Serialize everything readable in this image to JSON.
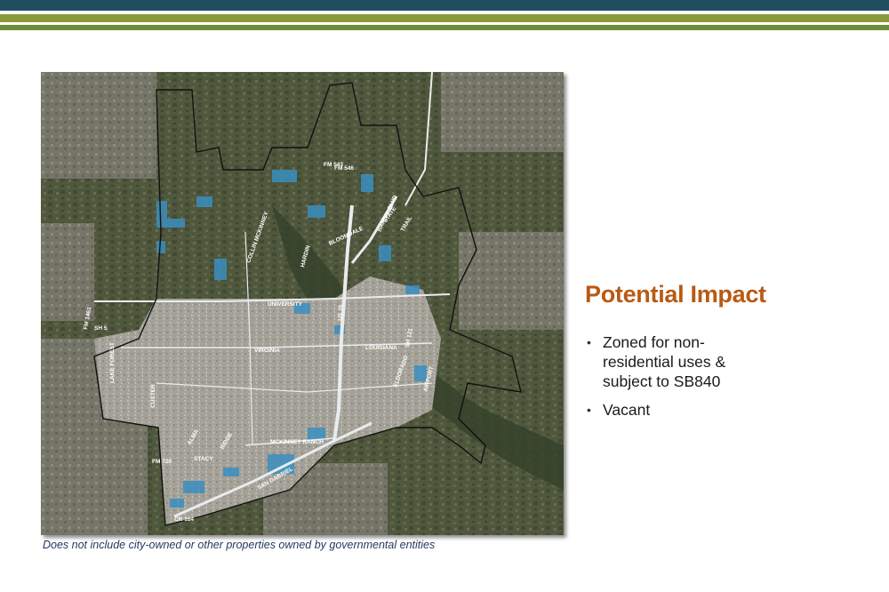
{
  "header_bands": [
    "#1f4e5f",
    "#8a9a3b",
    "#6d8c3a"
  ],
  "map": {
    "colors": {
      "base": "#4a5238",
      "urban": "#a7a59c",
      "vacant_parcel": "#3b8fbf",
      "city_boundary": "#111111",
      "road": "#e8ecef"
    },
    "road_labels": [
      "FM 543",
      "UNIVERSITY",
      "VIRGINIA",
      "LOUISIANA",
      "MCKINNEY RANCH",
      "STACY",
      "ALMA",
      "RIDGE",
      "FM 720",
      "CUSTER",
      "LAKE FOREST",
      "HARDIN",
      "COLLIN MCKINNEY",
      "SAN GABRIEL",
      "BLOOMDALE",
      "HARDIN BLVD",
      "AIRPORT",
      "STATE",
      "FM 1461",
      "SH 121",
      "US 75",
      "SH 5",
      "ELDORADO",
      "TRAIL",
      "CR 164",
      "FM 546"
    ]
  },
  "caption": "Does not include city-owned or other properties owned by governmental entities",
  "impact": {
    "title": "Potential Impact",
    "bullets": [
      "Zoned for non-residential uses & subject to SB840",
      "Vacant"
    ]
  }
}
